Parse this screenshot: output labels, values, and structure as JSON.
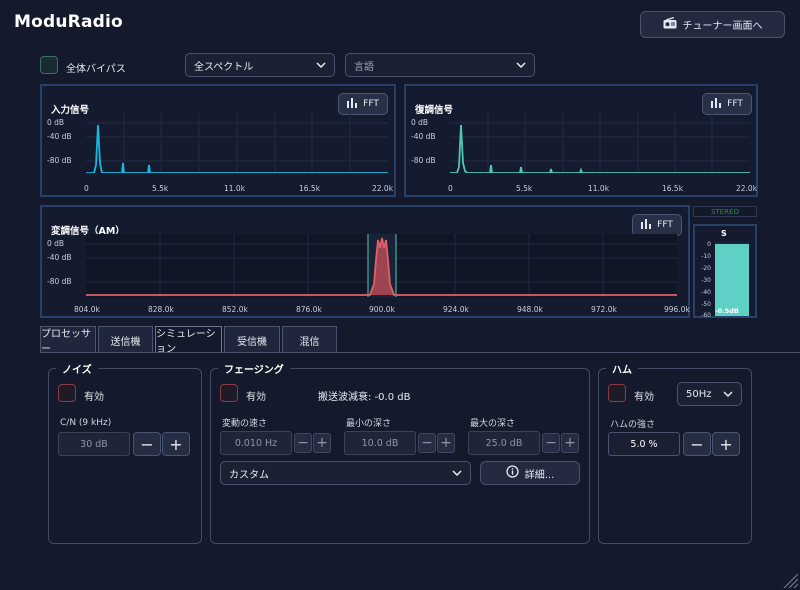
{
  "app": {
    "title": "ModuRadio"
  },
  "header": {
    "tuner_button": "チューナー画面へ",
    "tuner_icon": "radio-icon"
  },
  "controls": {
    "bypass_label": "全体バイパス",
    "spectrum_select": "全スペクトル",
    "language_select_placeholder": "言語"
  },
  "input_panel": {
    "title": "入力信号",
    "fft_label": "FFT",
    "y_ticks": [
      "0 dB",
      "-40 dB",
      "-80 dB"
    ],
    "x_ticks": [
      "0",
      "5.5k",
      "11.0k",
      "16.5k",
      "22.0k"
    ]
  },
  "demod_panel": {
    "title": "復調信号",
    "fft_label": "FFT",
    "y_ticks": [
      "0 dB",
      "-40 dB",
      "-80 dB"
    ],
    "x_ticks": [
      "0",
      "5.5k",
      "11.0k",
      "16.5k",
      "22.0k"
    ]
  },
  "mod_panel": {
    "title": "変調信号（AM）",
    "fft_label": "FFT",
    "y_ticks": [
      "0 dB",
      "-40 dB",
      "-80 dB"
    ],
    "x_ticks": [
      "804.0k",
      "828.0k",
      "852.0k",
      "876.0k",
      "900.0k",
      "924.0k",
      "948.0k",
      "972.0k",
      "996.0k"
    ]
  },
  "meter": {
    "stereo_label": "STEREO",
    "channel": "S",
    "ticks": [
      "0",
      "-10",
      "-20",
      "-30",
      "-40",
      "-50",
      "-60"
    ],
    "value_label": "-0.5dB",
    "level_fraction": 0.97
  },
  "tabs": [
    "プロセッサー",
    "送信機",
    "シミュレーション",
    "受信機",
    "混信"
  ],
  "active_tab": "シミュレーション",
  "noise": {
    "title": "ノイズ",
    "enabled_label": "有効",
    "cn_label": "C/N (9 kHz)",
    "cn_value": "30 dB"
  },
  "fading": {
    "title": "フェージング",
    "enabled_label": "有効",
    "carrier_attenuation": "搬送波減衰: -0.0 dB",
    "speed_label": "変動の速さ",
    "speed_value": "0.010 Hz",
    "min_depth_label": "最小の深さ",
    "min_depth_value": "10.0 dB",
    "max_depth_label": "最大の深さ",
    "max_depth_value": "25.0 dB",
    "preset_select": "カスタム",
    "details_button": "詳細...",
    "details_icon": "info-icon"
  },
  "hum": {
    "title": "ハム",
    "enabled_label": "有効",
    "freq_select": "50Hz",
    "strength_label": "ハムの強さ",
    "strength_value": "5.0 %"
  },
  "colors": {
    "input_trace": "#19b8de",
    "demod_trace": "#4ec8b5",
    "mod_trace": "#e0606a",
    "meter_fill": "#5fd0c6",
    "panel_border": "#26406a"
  }
}
